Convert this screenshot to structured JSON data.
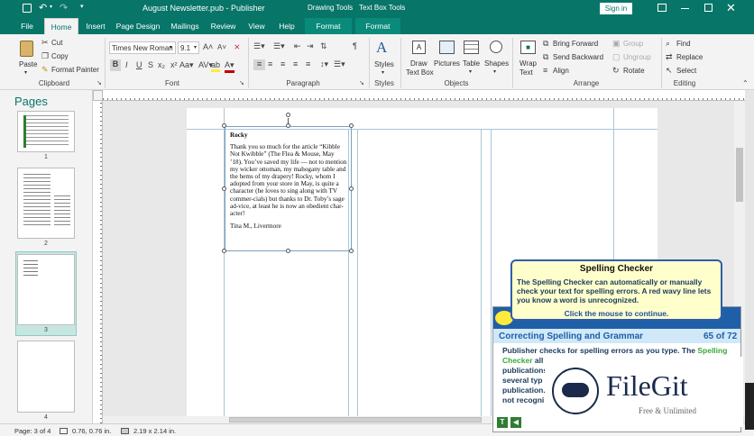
{
  "titlebar": {
    "doc_title": "August Newsletter.pub - Publisher",
    "drawing_tools": "Drawing Tools",
    "textbox_tools": "Text Box Tools",
    "sign_in": "Sign in"
  },
  "tabs": {
    "file": "File",
    "home": "Home",
    "insert": "Insert",
    "page_design": "Page Design",
    "mailings": "Mailings",
    "review": "Review",
    "view": "View",
    "help": "Help",
    "format1": "Format",
    "format2": "Format"
  },
  "clipboard": {
    "paste": "Paste",
    "cut": "Cut",
    "copy": "Copy",
    "format_painter": "Format Painter",
    "group": "Clipboard"
  },
  "font": {
    "name": "Times New Roman",
    "size": "9.1",
    "group": "Font"
  },
  "paragraph": {
    "group": "Paragraph"
  },
  "styles": {
    "label": "Styles",
    "group": "Styles"
  },
  "objects": {
    "draw_text_box_1": "Draw",
    "draw_text_box_2": "Text Box",
    "pictures": "Pictures",
    "table": "Table",
    "shapes": "Shapes",
    "group": "Objects"
  },
  "arrange": {
    "wrap1": "Wrap",
    "wrap2": "Text",
    "bring_forward": "Bring Forward",
    "send_backward": "Send Backward",
    "align": "Align",
    "group_btn": "Group",
    "ungroup": "Ungroup",
    "rotate": "Rotate",
    "group": "Arrange"
  },
  "editing": {
    "find": "Find",
    "replace": "Replace",
    "select": "Select",
    "group": "Editing"
  },
  "pages_pane": {
    "title": "Pages",
    "p1": "1",
    "p2": "2",
    "p3": "3",
    "p4": "4"
  },
  "article": {
    "heading": "Rocky",
    "body": "Thank you so much for the article “Kibble Not Kwibble” (The Flea & Mouse, May ’18). You’ve saved my life — not to mention my wicker ottoman, my mahogany table and the hems of my drapery! Rocky, whom I adopted from your store in May, is quite a character (he loves to sing along with TV commer-cials) but thanks to Dr. Toby’s sage ad-vice, at least he is now an obedient char-acter!",
    "signature": "Tina M., Livermore"
  },
  "status": {
    "page": "Page: 3 of 4",
    "position": "0.76, 0.76 in.",
    "size": "2.19 x 2.14 in."
  },
  "callout": {
    "title": "Spelling Checker",
    "body": "The Spelling Checker can automatically or manually check your text for spelling errors. A red wavy line lets you know a word is unrecognized.",
    "continue": "Click the mouse to continue."
  },
  "tutorial": {
    "header": "Correcting Spelling and Grammar",
    "counter": "65 of 72",
    "line1a": "Publisher checks for spelling errors as you type. The ",
    "line1b": "Spelling",
    "line2a": "Checker",
    "line2b": " all",
    "line3": "publications",
    "line4": "several typ",
    "line5": "publication.",
    "line6": "not recogni"
  },
  "watermark": {
    "brand": "FileGit",
    "tagline": "Free & Unlimited"
  }
}
